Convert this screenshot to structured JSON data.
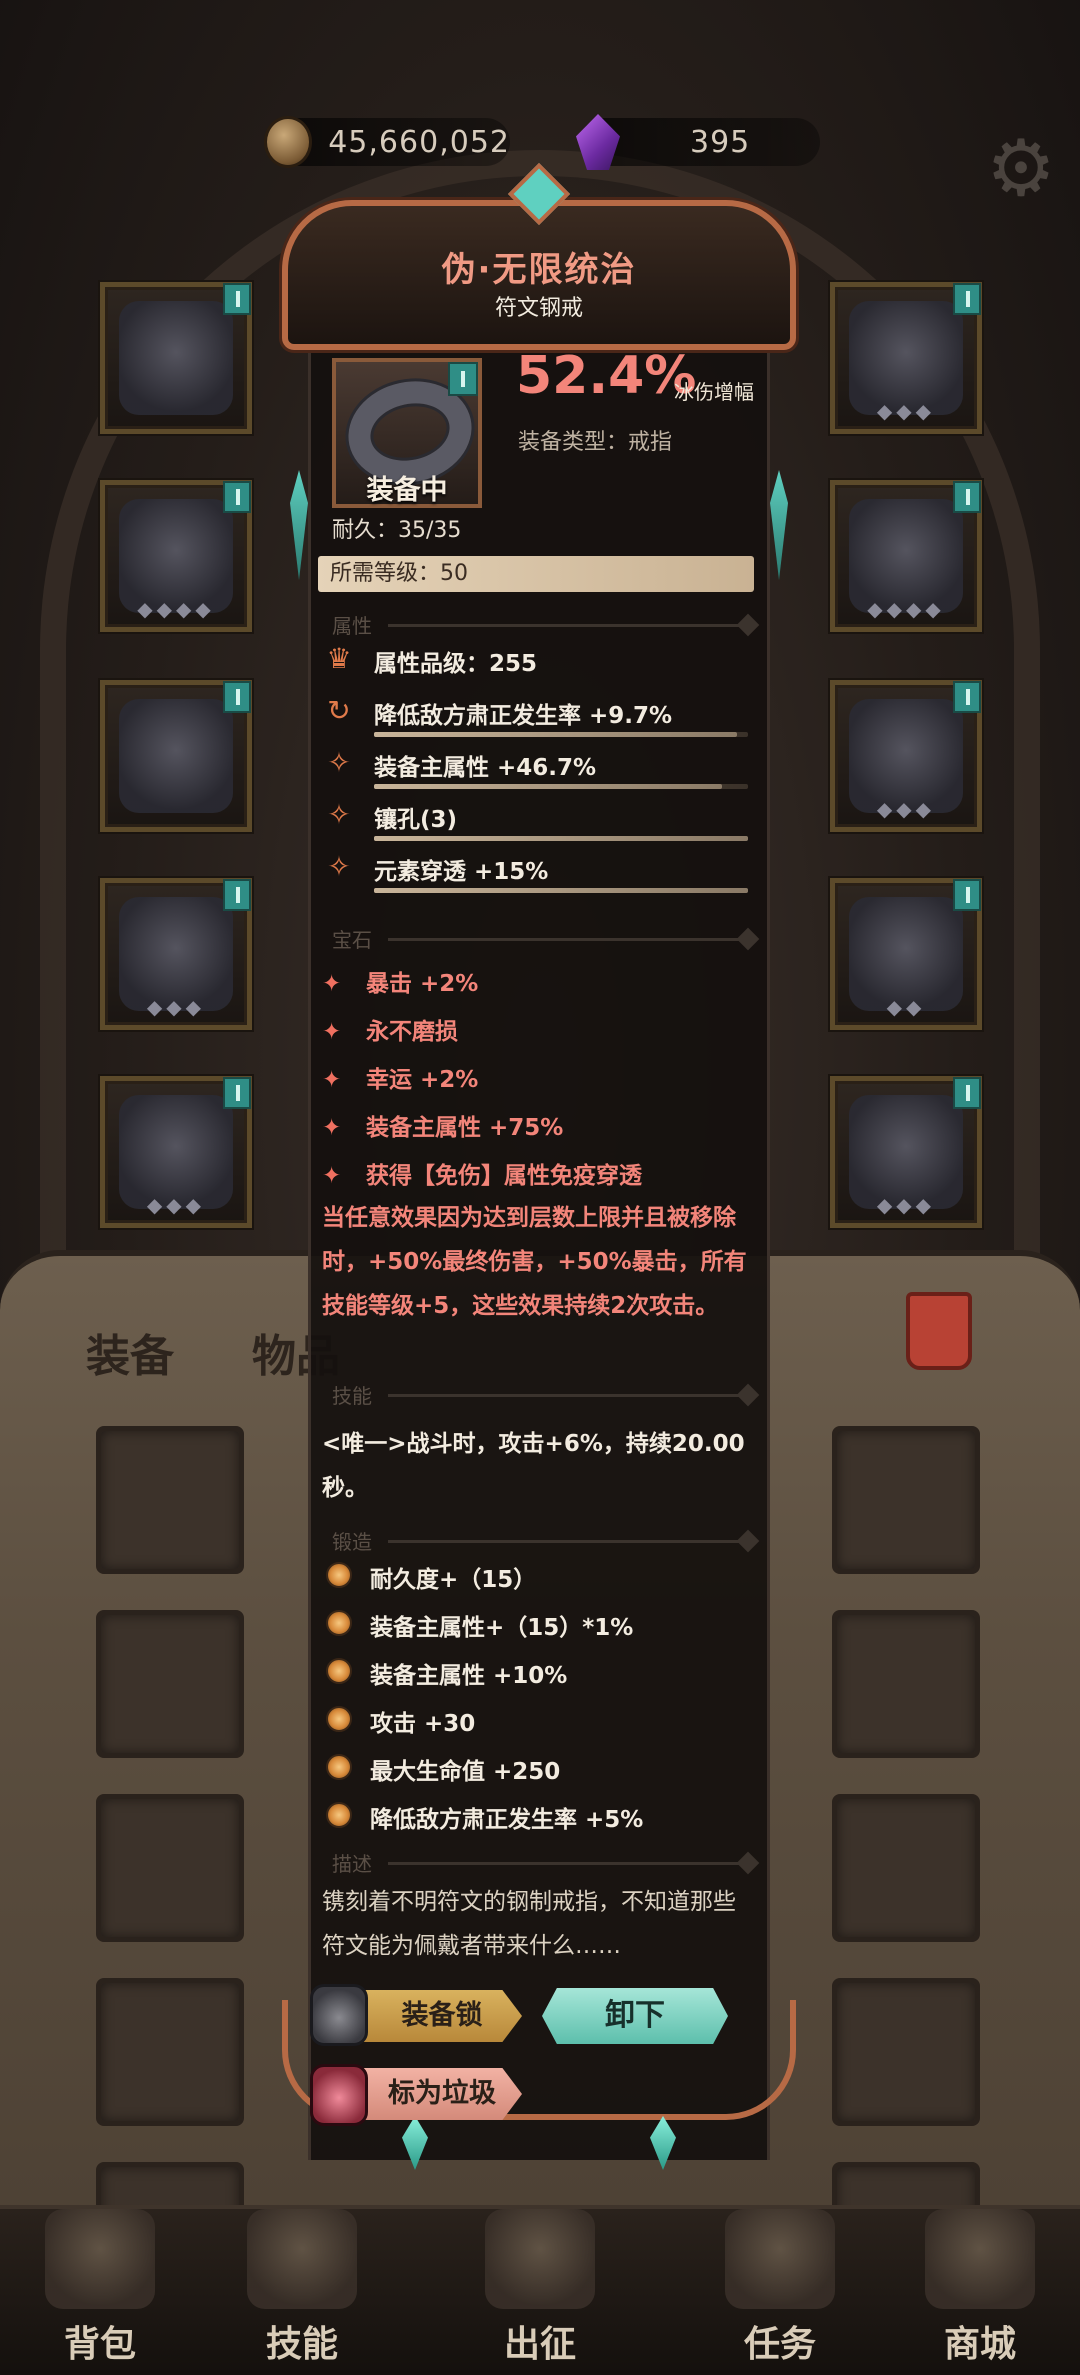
{
  "resources": {
    "gold": "45,660,052",
    "gems": "395"
  },
  "tabs": {
    "equipment": "装备",
    "items": "物品"
  },
  "item": {
    "name": "伪·无限统治",
    "type_name": "符文钢戒",
    "equipped_label": "装备中",
    "main_percent": "52.4%",
    "main_percent_label": "冰伤增幅",
    "equip_type": "装备类型：戒指",
    "durability": "耐久：35/35",
    "required_level": "所需等级：50"
  },
  "sections": {
    "attributes": "属性",
    "gems": "宝石",
    "skills": "技能",
    "forge": "锻造",
    "description": "描述"
  },
  "attributes": [
    {
      "icon": "crown-icon",
      "text": "属性品级：255",
      "fill": null
    },
    {
      "icon": "cycle-icon",
      "text": "降低敌方肃正发生率 +9.7%",
      "fill": 0.97
    },
    {
      "icon": "spark-icon",
      "text": "装备主属性 +46.7%",
      "fill": 0.93
    },
    {
      "icon": "spark-icon",
      "text": "镶孔(3)",
      "fill": 1.0
    },
    {
      "icon": "spark-icon",
      "text": "元素穿透 +15%",
      "fill": 1.0
    }
  ],
  "gems": [
    "暴击 +2%",
    "永不磨损",
    "幸运 +2%",
    "装备主属性 +75%",
    "获得【免伤】属性免疫穿透"
  ],
  "gem_effect": "当任意效果因为达到层数上限并且被移除时，+50%最终伤害，+50%暴击，所有技能等级+5，这些效果持续2次攻击。",
  "skill": "<唯一>战斗时，攻击+6%，持续20.00秒。",
  "forge": [
    "耐久度+（15）",
    "装备主属性+（15）*1%",
    "装备主属性 +10%",
    "攻击 +30",
    "最大生命值 +250",
    "降低敌方肃正发生率 +5%"
  ],
  "description": "镌刻着不明符文的钢制戒指，不知道那些符文能为佩戴者带来什么……",
  "buttons": {
    "lock": "装备锁",
    "unequip": "卸下",
    "junk": "标为垃圾"
  },
  "nav": [
    "背包",
    "技能",
    "出征",
    "任务",
    "商城"
  ],
  "colors": {
    "accent_red": "#f3857a",
    "teal": "#5dbfac",
    "gold": "#d9b25e"
  }
}
